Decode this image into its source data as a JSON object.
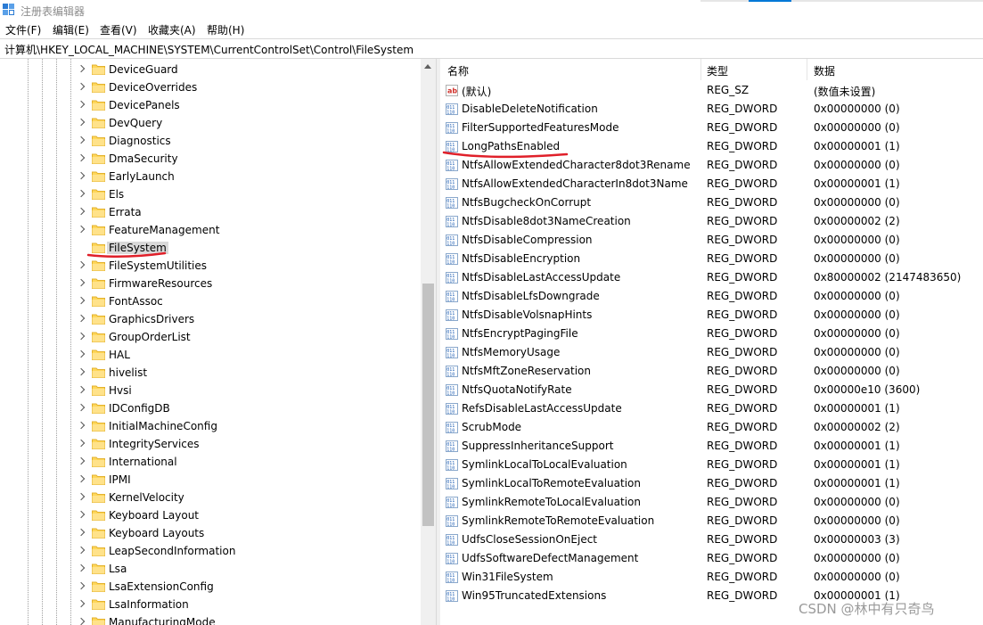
{
  "window": {
    "title": "注册表编辑器"
  },
  "menu": [
    "文件(F)",
    "编辑(E)",
    "查看(V)",
    "收藏夹(A)",
    "帮助(H)"
  ],
  "address": "计算机\\HKEY_LOCAL_MACHINE\\SYSTEM\\CurrentControlSet\\Control\\FileSystem",
  "tree": {
    "selected": "FileSystem",
    "items": [
      {
        "label": "DeviceGuard",
        "expandable": true
      },
      {
        "label": "DeviceOverrides",
        "expandable": true
      },
      {
        "label": "DevicePanels",
        "expandable": true
      },
      {
        "label": "DevQuery",
        "expandable": true
      },
      {
        "label": "Diagnostics",
        "expandable": true
      },
      {
        "label": "DmaSecurity",
        "expandable": true
      },
      {
        "label": "EarlyLaunch",
        "expandable": true
      },
      {
        "label": "Els",
        "expandable": true
      },
      {
        "label": "Errata",
        "expandable": true
      },
      {
        "label": "FeatureManagement",
        "expandable": true
      },
      {
        "label": "FileSystem",
        "expandable": false
      },
      {
        "label": "FileSystemUtilities",
        "expandable": true
      },
      {
        "label": "FirmwareResources",
        "expandable": true
      },
      {
        "label": "FontAssoc",
        "expandable": true
      },
      {
        "label": "GraphicsDrivers",
        "expandable": true
      },
      {
        "label": "GroupOrderList",
        "expandable": true
      },
      {
        "label": "HAL",
        "expandable": true
      },
      {
        "label": "hivelist",
        "expandable": true
      },
      {
        "label": "Hvsi",
        "expandable": true
      },
      {
        "label": "IDConfigDB",
        "expandable": true
      },
      {
        "label": "InitialMachineConfig",
        "expandable": true
      },
      {
        "label": "IntegrityServices",
        "expandable": true
      },
      {
        "label": "International",
        "expandable": true
      },
      {
        "label": "IPMI",
        "expandable": true
      },
      {
        "label": "KernelVelocity",
        "expandable": true
      },
      {
        "label": "Keyboard Layout",
        "expandable": true
      },
      {
        "label": "Keyboard Layouts",
        "expandable": true
      },
      {
        "label": "LeapSecondInformation",
        "expandable": true
      },
      {
        "label": "Lsa",
        "expandable": true
      },
      {
        "label": "LsaExtensionConfig",
        "expandable": true
      },
      {
        "label": "LsaInformation",
        "expandable": true
      },
      {
        "label": "ManufacturingMode",
        "expandable": true
      }
    ]
  },
  "list": {
    "headers": {
      "name": "名称",
      "type": "类型",
      "data": "数据"
    },
    "rows": [
      {
        "name": "(默认)",
        "type": "REG_SZ",
        "data": "(数值未设置)",
        "kind": "string"
      },
      {
        "name": "DisableDeleteNotification",
        "type": "REG_DWORD",
        "data": "0x00000000 (0)",
        "kind": "binary"
      },
      {
        "name": "FilterSupportedFeaturesMode",
        "type": "REG_DWORD",
        "data": "0x00000000 (0)",
        "kind": "binary"
      },
      {
        "name": "LongPathsEnabled",
        "type": "REG_DWORD",
        "data": "0x00000001 (1)",
        "kind": "binary"
      },
      {
        "name": "NtfsAllowExtendedCharacter8dot3Rename",
        "type": "REG_DWORD",
        "data": "0x00000000 (0)",
        "kind": "binary"
      },
      {
        "name": "NtfsAllowExtendedCharacterIn8dot3Name",
        "type": "REG_DWORD",
        "data": "0x00000001 (1)",
        "kind": "binary"
      },
      {
        "name": "NtfsBugcheckOnCorrupt",
        "type": "REG_DWORD",
        "data": "0x00000000 (0)",
        "kind": "binary"
      },
      {
        "name": "NtfsDisable8dot3NameCreation",
        "type": "REG_DWORD",
        "data": "0x00000002 (2)",
        "kind": "binary"
      },
      {
        "name": "NtfsDisableCompression",
        "type": "REG_DWORD",
        "data": "0x00000000 (0)",
        "kind": "binary"
      },
      {
        "name": "NtfsDisableEncryption",
        "type": "REG_DWORD",
        "data": "0x00000000 (0)",
        "kind": "binary"
      },
      {
        "name": "NtfsDisableLastAccessUpdate",
        "type": "REG_DWORD",
        "data": "0x80000002 (2147483650)",
        "kind": "binary"
      },
      {
        "name": "NtfsDisableLfsDowngrade",
        "type": "REG_DWORD",
        "data": "0x00000000 (0)",
        "kind": "binary"
      },
      {
        "name": "NtfsDisableVolsnapHints",
        "type": "REG_DWORD",
        "data": "0x00000000 (0)",
        "kind": "binary"
      },
      {
        "name": "NtfsEncryptPagingFile",
        "type": "REG_DWORD",
        "data": "0x00000000 (0)",
        "kind": "binary"
      },
      {
        "name": "NtfsMemoryUsage",
        "type": "REG_DWORD",
        "data": "0x00000000 (0)",
        "kind": "binary"
      },
      {
        "name": "NtfsMftZoneReservation",
        "type": "REG_DWORD",
        "data": "0x00000000 (0)",
        "kind": "binary"
      },
      {
        "name": "NtfsQuotaNotifyRate",
        "type": "REG_DWORD",
        "data": "0x00000e10 (3600)",
        "kind": "binary"
      },
      {
        "name": "RefsDisableLastAccessUpdate",
        "type": "REG_DWORD",
        "data": "0x00000001 (1)",
        "kind": "binary"
      },
      {
        "name": "ScrubMode",
        "type": "REG_DWORD",
        "data": "0x00000002 (2)",
        "kind": "binary"
      },
      {
        "name": "SuppressInheritanceSupport",
        "type": "REG_DWORD",
        "data": "0x00000001 (1)",
        "kind": "binary"
      },
      {
        "name": "SymlinkLocalToLocalEvaluation",
        "type": "REG_DWORD",
        "data": "0x00000001 (1)",
        "kind": "binary"
      },
      {
        "name": "SymlinkLocalToRemoteEvaluation",
        "type": "REG_DWORD",
        "data": "0x00000001 (1)",
        "kind": "binary"
      },
      {
        "name": "SymlinkRemoteToLocalEvaluation",
        "type": "REG_DWORD",
        "data": "0x00000000 (0)",
        "kind": "binary"
      },
      {
        "name": "SymlinkRemoteToRemoteEvaluation",
        "type": "REG_DWORD",
        "data": "0x00000000 (0)",
        "kind": "binary"
      },
      {
        "name": "UdfsCloseSessionOnEject",
        "type": "REG_DWORD",
        "data": "0x00000003 (3)",
        "kind": "binary"
      },
      {
        "name": "UdfsSoftwareDefectManagement",
        "type": "REG_DWORD",
        "data": "0x00000000 (0)",
        "kind": "binary"
      },
      {
        "name": "Win31FileSystem",
        "type": "REG_DWORD",
        "data": "0x00000000 (0)",
        "kind": "binary"
      },
      {
        "name": "Win95TruncatedExtensions",
        "type": "REG_DWORD",
        "data": "0x00000001 (1)",
        "kind": "binary"
      }
    ]
  },
  "watermark": "CSDN @林中有只奇鸟",
  "colors": {
    "accent": "#0078d7",
    "annotation": "#e0202a",
    "folder": "#ffd75a"
  }
}
